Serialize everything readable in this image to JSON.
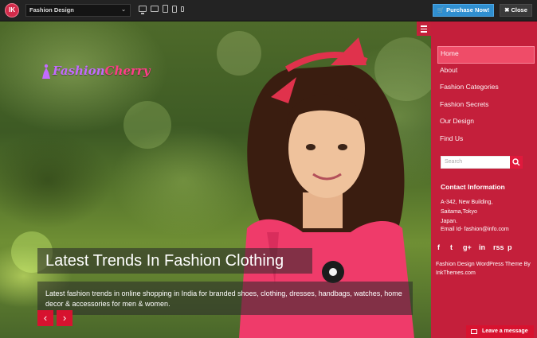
{
  "toolbar": {
    "badge": "IK",
    "theme_select": "Fashion Design",
    "purchase_label": "Purchase Now!",
    "close_label": "Close",
    "devices": [
      "desktop-icon",
      "laptop-icon",
      "tablet-icon",
      "tablet-small-icon",
      "phone-icon"
    ]
  },
  "site": {
    "brand_part1": "Fashion",
    "brand_part2": "Cherry"
  },
  "slider": {
    "title": "Latest Trends In Fashion Clothing",
    "description": "Latest fashion trends in online shopping in India for branded shoes, clothing, dresses, handbags, watches, home decor & accessories for men & women.",
    "prev": "‹",
    "next": "›"
  },
  "sidebar": {
    "nav": [
      "Home",
      "About",
      "Fashion Categories",
      "Fashion Secrets",
      "Our Design",
      "Find Us"
    ],
    "active_nav": "Home",
    "search_placeholder": "Search",
    "contact_heading": "Contact Information",
    "contact_lines": [
      "A-342, New Building,",
      "Saitama,Tokyo",
      "Japan.",
      "Email Id- fashion@info.com"
    ],
    "social": [
      "f",
      "t",
      "g+",
      "in",
      "rss",
      "p"
    ],
    "credit": "Fashion Design WordPress Theme By InkThemes.com"
  },
  "chat": {
    "label": "Leave a message"
  },
  "colors": {
    "sidebar": "#c41f3b",
    "active_nav": "#f24f6b",
    "accent_red": "#d7122f",
    "purchase_blue": "#2f8fd0"
  }
}
